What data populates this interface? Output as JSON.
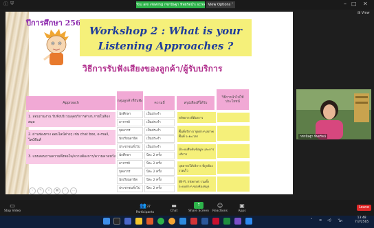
{
  "window": {
    "banner_text": "You are viewing กชกนิษฐา ทิพยรัตน์'s screen",
    "view_options": "View Options ˅",
    "view_button": "⊞ View"
  },
  "slide": {
    "year": "ปีการศึกษา 2564",
    "title_line1": "Workshop 2 : What is your",
    "title_line2": "Listening Approaches ?",
    "subtitle": "วิธีการรับฟังเสียงของลูกค้า/ผู้รับบริการ",
    "headers": {
      "approach": "Approach",
      "group": "กลุ่มลูกค้าที่รับฟัง",
      "freq": "ความถี่",
      "summary": "สรุปเสียงที่ได้รับ",
      "benefit": "วิธีการนำไปใช้ประโยชน์"
    },
    "approaches": [
      "1. สอบถามงาน รับฟังบริเวณจุดบริการต่างๆ ภายในห้องสมุด",
      "2. ผ่านช่องทาง ออนไลน์ต่างๆ เช่น chat box, e-mail, ไลน์ทีมส์",
      "3. แบบสอบถามความพึงพอใจ/ความต้องการ/ความคาดหวัง"
    ],
    "groups": [
      "นักศึกษา",
      "อาจารย์",
      "บุคลากร",
      "นักเรียนสาธิต",
      "ประชาชนทั่วไป",
      "นักศึกษา",
      "อาจารย์",
      "บุคลากร",
      "นักเรียนสาธิต",
      "ประชาชนทั่วไป"
    ],
    "freqs": [
      "เป็นประจำ",
      "เป็นประจำ",
      "เป็นประจำ",
      "เป็นประจำ",
      "เป็นประจำ",
      "ปีละ 2 ครั้ง",
      "ปีละ 2 ครั้ง",
      "ปีละ 2 ครั้ง",
      "ปีละ 2 ครั้ง",
      "ปีละ 2 ครั้ง"
    ],
    "notes": [
      "ทรัพยากรที่ต้องการ",
      "พื้นที่บริการ/ จุดต่างๆ สภาพพื้นที่ ระยะเวลา",
      "มีระบบสืบค้นข้อมูล และการบริการ",
      "บุคลากรให้บริการ ที่ถูกต้องรวดเร็ว",
      "Wi-Fi, Internet รวมทั้งระบบต่างๆ ของห้องสมุด"
    ]
  },
  "participant": {
    "name": "กชกนิษฐา ทิพยรัตน์"
  },
  "toolbar": {
    "stop_video": "Stop Video",
    "participants_count": "37",
    "participants": "Participants",
    "chat": "Chat",
    "share_screen": "Share Screen",
    "reactions": "Reactions",
    "apps": "Apps",
    "leave": "Leave"
  },
  "taskbar": {
    "time": "13:48",
    "date": "7/7/2565"
  }
}
